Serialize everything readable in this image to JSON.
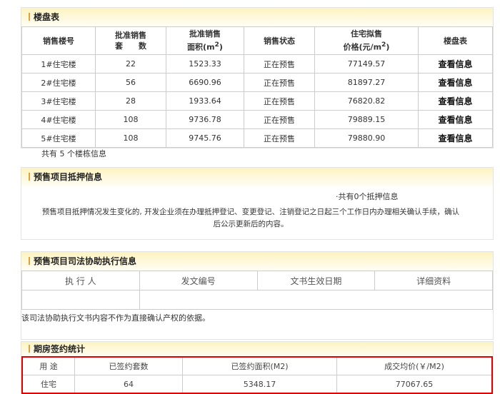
{
  "buildings": {
    "title": "楼盘表",
    "headers": {
      "h1": "销售楼号",
      "h2a": "批准销售",
      "h2b": "套　　数",
      "h3a": "批准销售",
      "h3b": "面积(m",
      "h4": "销售状态",
      "h5a": "住宅拟售",
      "h5b": "价格(元/m",
      "h6": "楼盘表",
      "sup": "2",
      "close": ")"
    },
    "rows": [
      {
        "name": "1#住宅楼",
        "units": "22",
        "area": "1523.33",
        "status": "正在预售",
        "price": "77149.57",
        "link": "查看信息"
      },
      {
        "name": "2#住宅楼",
        "units": "56",
        "area": "6690.96",
        "status": "正在预售",
        "price": "81897.27",
        "link": "查看信息"
      },
      {
        "name": "3#住宅楼",
        "units": "28",
        "area": "1933.64",
        "status": "正在预售",
        "price": "76820.82",
        "link": "查看信息"
      },
      {
        "name": "4#住宅楼",
        "units": "108",
        "area": "9736.78",
        "status": "正在预售",
        "price": "79889.15",
        "link": "查看信息"
      },
      {
        "name": "5#住宅楼",
        "units": "108",
        "area": "9745.76",
        "status": "正在预售",
        "price": "79880.90",
        "link": "查看信息"
      }
    ],
    "footer": "共有 5 个楼栋信息"
  },
  "mortgage": {
    "title": "预售项目抵押信息",
    "count": "·共有0个抵押信息",
    "note1": "预售项目抵押情况发生变化的, 开发企业须在办理抵押登记、变更登记、注销登记之日起三个工作日内办理相关确认手续，确认",
    "note2": "后公示更新后的内容。"
  },
  "judicial": {
    "title": "预售项目司法协助执行信息",
    "headers": [
      "执 行 人",
      "发文编号",
      "文书生效日期",
      "详细资料"
    ],
    "note": "该司法协助执行文书内容不作为直接确认产权的依据。"
  },
  "contracts": {
    "title": "期房签约统计",
    "headers": [
      "用 途",
      "已签约套数",
      "已签约面积(M2)",
      "成交均价(￥/M2)"
    ],
    "row": [
      "住宅",
      "64",
      "5348.17",
      "77067.65"
    ]
  }
}
